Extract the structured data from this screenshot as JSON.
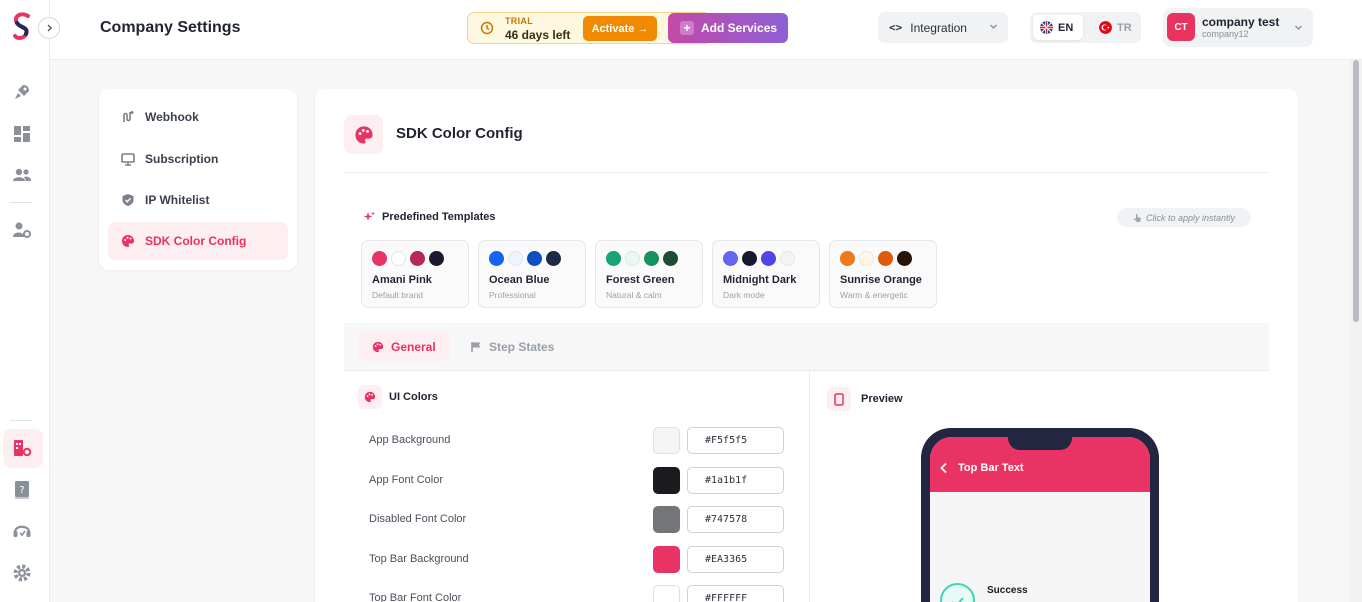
{
  "header": {
    "title": "Company Settings",
    "trial_label": "TRIAL",
    "trial_days": "46 days left",
    "activate_label": "Activate →",
    "add_services_label": "Add Services",
    "integration_label": "Integration",
    "lang_en": "EN",
    "lang_tr": "TR",
    "user_initials": "CT",
    "user_name": "company test",
    "user_company": "company12"
  },
  "rail": {
    "icons": [
      "rocket-icon",
      "dashboard-icon",
      "users-icon",
      "user-settings-icon",
      "company-settings-icon",
      "help-book-icon",
      "support-icon",
      "gear-icon"
    ]
  },
  "settings_nav": {
    "items": [
      {
        "label": "Webhook",
        "icon": "webhook-icon"
      },
      {
        "label": "Subscription",
        "icon": "monitor-icon"
      },
      {
        "label": "IP Whitelist",
        "icon": "shield-icon"
      },
      {
        "label": "SDK Color Config",
        "icon": "palette-icon",
        "active": true
      }
    ]
  },
  "main": {
    "title": "SDK Color Config",
    "predefined_title": "Predefined Templates",
    "predefined_hint": "Click to apply instantly",
    "templates": [
      {
        "name": "Amani Pink",
        "desc": "Default brand",
        "colors": [
          "#EA3365",
          "#ffffff",
          "#b8285a",
          "#1a1b2e"
        ]
      },
      {
        "name": "Ocean Blue",
        "desc": "Professional",
        "colors": [
          "#1565f0",
          "#eef4ff",
          "#0b4fc0",
          "#1d2a44"
        ]
      },
      {
        "name": "Forest Green",
        "desc": "Natural & calm",
        "colors": [
          "#17a673",
          "#eaf8f1",
          "#15925f",
          "#1d4d33"
        ]
      },
      {
        "name": "Midnight Dark",
        "desc": "Dark mode",
        "colors": [
          "#6366f1",
          "#151a2e",
          "#4f46e5",
          "#f3f4f6"
        ]
      },
      {
        "name": "Sunrise Orange",
        "desc": "Warm & energetic",
        "colors": [
          "#f07a1a",
          "#fff6ea",
          "#e05a0c",
          "#2a1408"
        ]
      }
    ],
    "tabs": {
      "general": "General",
      "step_states": "Step States"
    },
    "ui_colors_title": "UI Colors",
    "ui_colors": [
      {
        "label": "App Background",
        "hex": "#F5f5f5",
        "color": "#F5f5f5"
      },
      {
        "label": "App Font Color",
        "hex": "#1a1b1f",
        "color": "#1a1b1f"
      },
      {
        "label": "Disabled Font Color",
        "hex": "#747578",
        "color": "#747578"
      },
      {
        "label": "Top Bar Background",
        "hex": "#EA3365",
        "color": "#EA3365"
      },
      {
        "label": "Top Bar Font Color",
        "hex": "#FFFFFF",
        "color": "#FFFFFF"
      }
    ],
    "preview_title": "Preview",
    "preview": {
      "top_bar_text": "Top Bar Text",
      "success_text": "Success"
    }
  }
}
